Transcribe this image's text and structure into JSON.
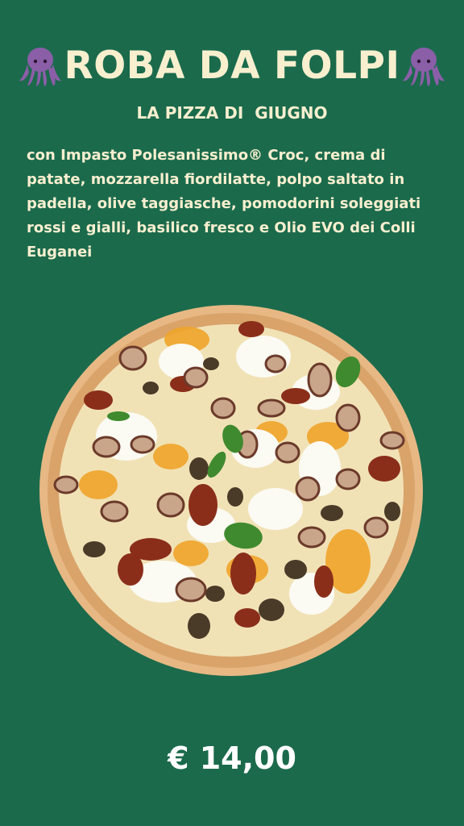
{
  "header": {
    "title": "ROBA DA FOLPI",
    "left_icon": "octopus-icon",
    "right_icon": "octopus-icon"
  },
  "subtitle": "LA PIZZA DI  GIUGNO",
  "description": "con Impasto Polesanissimo® Croc, crema di patate, mozzarella fiordilatte, polpo saltato in padella, olive taggiasche, pomodorini soleggiati rossi e gialli, basilico fresco e Olio EVO dei Colli Euganei",
  "price": "€ 14,00",
  "colors": {
    "background": "#1b6a4c",
    "title": "#f8efcf",
    "octopus": "#8b5ea8",
    "price": "#ffffff"
  }
}
